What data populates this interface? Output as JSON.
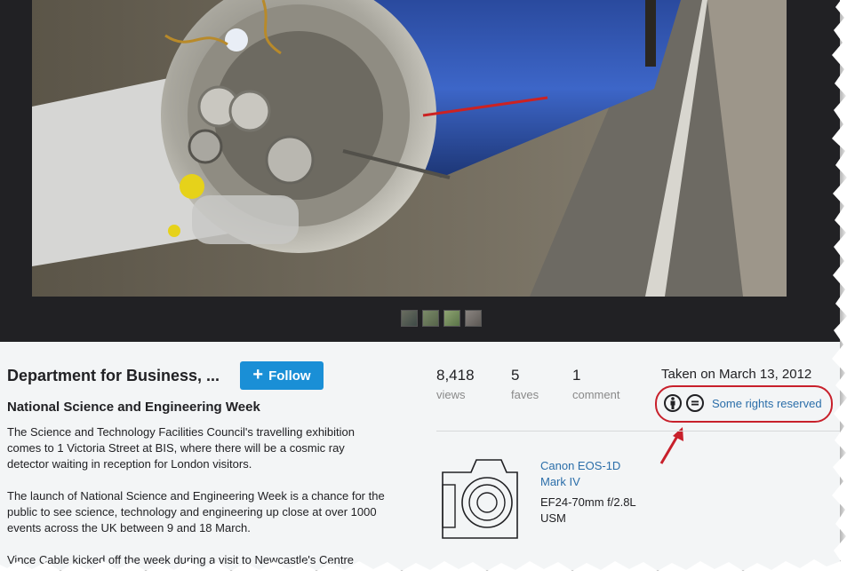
{
  "owner": {
    "name": "Department for Business, ...",
    "follow_label": "Follow"
  },
  "photo": {
    "title": "National Science and Engineering Week",
    "description": [
      "The Science and Technology Facilities Council's travelling exhibition comes to 1 Victoria Street at BIS, where there will be a cosmic ray detector waiting in reception for London visitors.",
      "The launch of National Science and Engineering Week is a chance for the public to see science, technology and engineering up close at over 1000 events across the UK between 9 and 18 March.",
      "Vince Cable kicked off the week during a visit to Newcastle's Centre"
    ]
  },
  "stats": {
    "views": {
      "value": "8,418",
      "label": "views"
    },
    "faves": {
      "value": "5",
      "label": "faves"
    },
    "comments": {
      "value": "1",
      "label": "comment"
    }
  },
  "taken": "Taken on March 13, 2012",
  "license": {
    "text": "Some rights reserved",
    "icons": [
      "cc-attribution-icon",
      "cc-no-derivatives-icon"
    ]
  },
  "exif": {
    "camera": "Canon EOS-1D Mark IV",
    "lens": "EF24-70mm f/2.8L USM"
  },
  "colors": {
    "accent": "#1a8fd6",
    "link": "#2b6ea9",
    "annotation": "#c8202b",
    "viewer_bg": "#212124"
  }
}
